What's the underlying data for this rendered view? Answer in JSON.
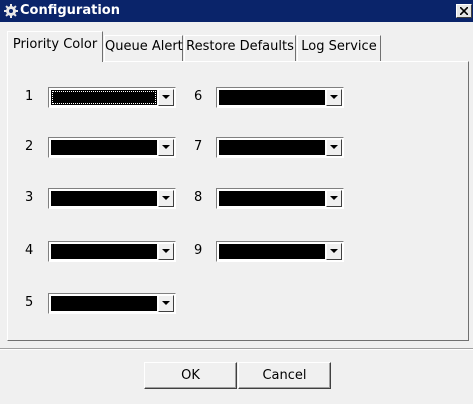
{
  "window": {
    "title": "Configuration",
    "icon": "gear-icon",
    "close_icon": "close-icon"
  },
  "tabs": [
    {
      "label": "Priority Color",
      "active": true
    },
    {
      "label": "Queue Alert",
      "active": false
    },
    {
      "label": "Restore Defaults",
      "active": false
    },
    {
      "label": "Log Service",
      "active": false
    }
  ],
  "priority_colors": [
    {
      "label": "1",
      "selected_color": "#000000",
      "focused": true
    },
    {
      "label": "2",
      "selected_color": "#000000"
    },
    {
      "label": "3",
      "selected_color": "#000000"
    },
    {
      "label": "4",
      "selected_color": "#000000"
    },
    {
      "label": "5",
      "selected_color": "#000000"
    },
    {
      "label": "6",
      "selected_color": "#000000"
    },
    {
      "label": "7",
      "selected_color": "#000000"
    },
    {
      "label": "8",
      "selected_color": "#000000"
    },
    {
      "label": "9",
      "selected_color": "#000000"
    }
  ],
  "buttons": {
    "ok": "OK",
    "cancel": "Cancel"
  },
  "colors": {
    "titlebar": "#0a246a",
    "face": "#f0f0f0"
  }
}
